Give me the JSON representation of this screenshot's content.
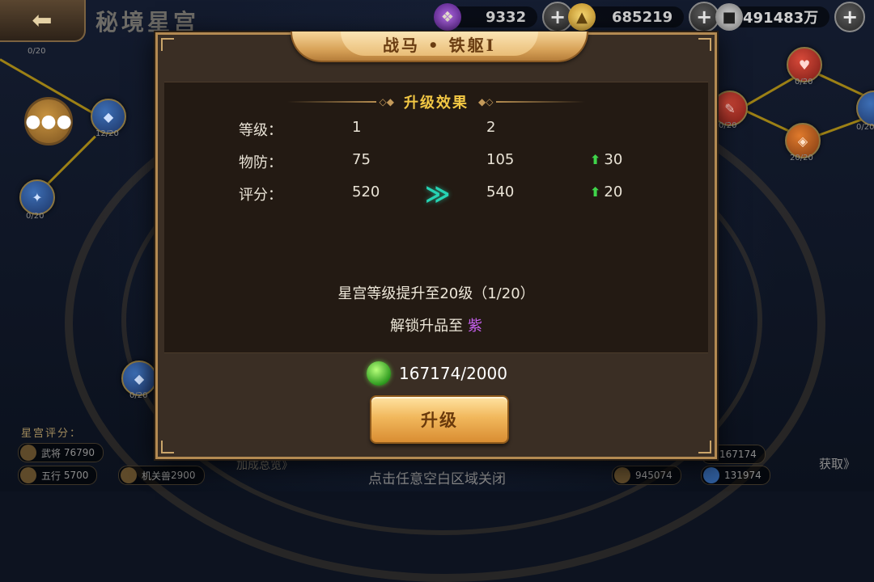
{
  "header": {
    "back_icon": "back-arrow-icon",
    "title": "秘境星宫",
    "resources": [
      {
        "icon": "purple-gem-icon",
        "value": "9332"
      },
      {
        "icon": "gold-ingot-icon",
        "value": "685219"
      },
      {
        "icon": "coin-icon",
        "value": "491483万"
      }
    ]
  },
  "chat_icon": "chat-bubble-icon",
  "node_counts": [
    "0/20",
    "12/20",
    "0/20",
    "0/20",
    "0/20",
    "0/20",
    "20/20",
    "0/20"
  ],
  "score_panel": {
    "title": "星宫评分：",
    "items": [
      {
        "label": "武将",
        "value": "76790"
      },
      {
        "label": "五行",
        "value": "5700"
      },
      {
        "label": "机关兽",
        "value": "2900"
      },
      {
        "label": "",
        "value": "945074"
      },
      {
        "label": "",
        "value": "131974"
      },
      {
        "label": "",
        "value": "167174"
      }
    ]
  },
  "skill_link": "加成总览》",
  "get_link": "获取》",
  "close_hint": "点击任意空白区域关闭",
  "dialog": {
    "title": "战马 • 铁躯Ⅰ",
    "effect_title": "升级效果",
    "rows": [
      {
        "label": "等级：",
        "current": "1",
        "next": "2",
        "increase": ""
      },
      {
        "label": "物防：",
        "current": "75",
        "next": "105",
        "increase": "30"
      },
      {
        "label": "评分：",
        "current": "520",
        "next": "540",
        "increase": "20"
      }
    ],
    "requirement": "星宫等级提升至20级（1/20）",
    "unlock_prefix": "解锁升品至",
    "unlock_value": "紫",
    "unlock_color": "#c660ee",
    "cost": "167174/2000",
    "cost_icon": "green-gem-icon",
    "upgrade_label": "升级"
  }
}
